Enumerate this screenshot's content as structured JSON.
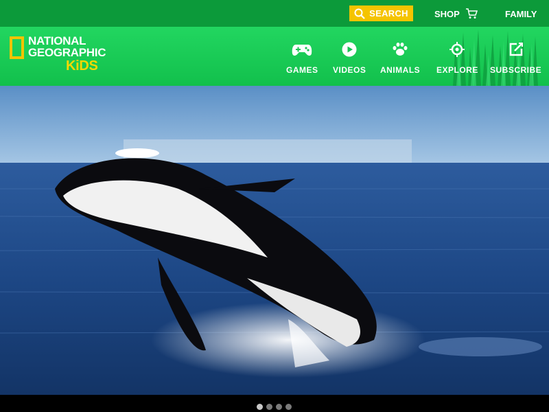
{
  "topbar": {
    "search_label": "SEARCH",
    "shop_label": "SHOP",
    "family_label": "FAMILY"
  },
  "logo": {
    "line1": "NATIONAL",
    "line2": "GEOGRAPHIC",
    "line3": "KiDS"
  },
  "nav": {
    "items": [
      {
        "label": "GAMES",
        "icon": "gamepad-icon"
      },
      {
        "label": "VIDEOS",
        "icon": "play-icon"
      },
      {
        "label": "ANIMALS",
        "icon": "paw-icon"
      },
      {
        "label": "EXPLORE",
        "icon": "crosshair-icon"
      },
      {
        "label": "SUBSCRIBE",
        "icon": "edit-icon"
      }
    ]
  },
  "carousel": {
    "slide_count": 4,
    "active_index": 0
  },
  "colors": {
    "topbar": "#0c9a3a",
    "navbar": "#1dcf57",
    "accent_yellow": "#f5c400"
  }
}
